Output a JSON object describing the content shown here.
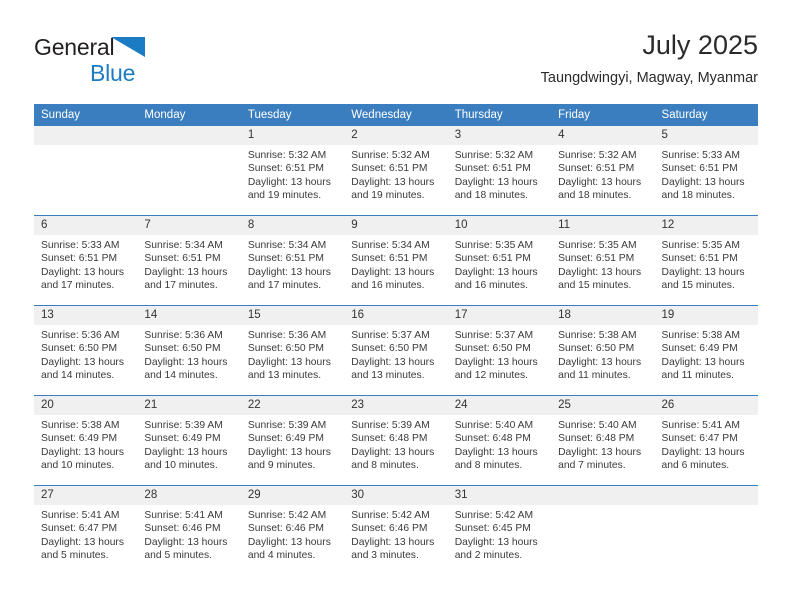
{
  "brand": {
    "name_part1": "General",
    "name_part2": "Blue",
    "logo_icon": "triangle-logo-icon",
    "color_dark": "#231f20",
    "color_blue": "#1b7cc4"
  },
  "header": {
    "title": "July 2025",
    "subtitle": "Taungdwingyi, Magway, Myanmar"
  },
  "theme": {
    "header_blue": "#3b7ebf",
    "daynum_band": "#f0f0f0",
    "text": "#3a3a3a"
  },
  "calendar": {
    "weekday_headers": [
      "Sunday",
      "Monday",
      "Tuesday",
      "Wednesday",
      "Thursday",
      "Friday",
      "Saturday"
    ],
    "weeks": [
      [
        {
          "day": "",
          "sunrise": "",
          "sunset": "",
          "daylight1": "",
          "daylight2": ""
        },
        {
          "day": "",
          "sunrise": "",
          "sunset": "",
          "daylight1": "",
          "daylight2": ""
        },
        {
          "day": "1",
          "sunrise": "Sunrise: 5:32 AM",
          "sunset": "Sunset: 6:51 PM",
          "daylight1": "Daylight: 13 hours",
          "daylight2": "and 19 minutes."
        },
        {
          "day": "2",
          "sunrise": "Sunrise: 5:32 AM",
          "sunset": "Sunset: 6:51 PM",
          "daylight1": "Daylight: 13 hours",
          "daylight2": "and 19 minutes."
        },
        {
          "day": "3",
          "sunrise": "Sunrise: 5:32 AM",
          "sunset": "Sunset: 6:51 PM",
          "daylight1": "Daylight: 13 hours",
          "daylight2": "and 18 minutes."
        },
        {
          "day": "4",
          "sunrise": "Sunrise: 5:32 AM",
          "sunset": "Sunset: 6:51 PM",
          "daylight1": "Daylight: 13 hours",
          "daylight2": "and 18 minutes."
        },
        {
          "day": "5",
          "sunrise": "Sunrise: 5:33 AM",
          "sunset": "Sunset: 6:51 PM",
          "daylight1": "Daylight: 13 hours",
          "daylight2": "and 18 minutes."
        }
      ],
      [
        {
          "day": "6",
          "sunrise": "Sunrise: 5:33 AM",
          "sunset": "Sunset: 6:51 PM",
          "daylight1": "Daylight: 13 hours",
          "daylight2": "and 17 minutes."
        },
        {
          "day": "7",
          "sunrise": "Sunrise: 5:34 AM",
          "sunset": "Sunset: 6:51 PM",
          "daylight1": "Daylight: 13 hours",
          "daylight2": "and 17 minutes."
        },
        {
          "day": "8",
          "sunrise": "Sunrise: 5:34 AM",
          "sunset": "Sunset: 6:51 PM",
          "daylight1": "Daylight: 13 hours",
          "daylight2": "and 17 minutes."
        },
        {
          "day": "9",
          "sunrise": "Sunrise: 5:34 AM",
          "sunset": "Sunset: 6:51 PM",
          "daylight1": "Daylight: 13 hours",
          "daylight2": "and 16 minutes."
        },
        {
          "day": "10",
          "sunrise": "Sunrise: 5:35 AM",
          "sunset": "Sunset: 6:51 PM",
          "daylight1": "Daylight: 13 hours",
          "daylight2": "and 16 minutes."
        },
        {
          "day": "11",
          "sunrise": "Sunrise: 5:35 AM",
          "sunset": "Sunset: 6:51 PM",
          "daylight1": "Daylight: 13 hours",
          "daylight2": "and 15 minutes."
        },
        {
          "day": "12",
          "sunrise": "Sunrise: 5:35 AM",
          "sunset": "Sunset: 6:51 PM",
          "daylight1": "Daylight: 13 hours",
          "daylight2": "and 15 minutes."
        }
      ],
      [
        {
          "day": "13",
          "sunrise": "Sunrise: 5:36 AM",
          "sunset": "Sunset: 6:50 PM",
          "daylight1": "Daylight: 13 hours",
          "daylight2": "and 14 minutes."
        },
        {
          "day": "14",
          "sunrise": "Sunrise: 5:36 AM",
          "sunset": "Sunset: 6:50 PM",
          "daylight1": "Daylight: 13 hours",
          "daylight2": "and 14 minutes."
        },
        {
          "day": "15",
          "sunrise": "Sunrise: 5:36 AM",
          "sunset": "Sunset: 6:50 PM",
          "daylight1": "Daylight: 13 hours",
          "daylight2": "and 13 minutes."
        },
        {
          "day": "16",
          "sunrise": "Sunrise: 5:37 AM",
          "sunset": "Sunset: 6:50 PM",
          "daylight1": "Daylight: 13 hours",
          "daylight2": "and 13 minutes."
        },
        {
          "day": "17",
          "sunrise": "Sunrise: 5:37 AM",
          "sunset": "Sunset: 6:50 PM",
          "daylight1": "Daylight: 13 hours",
          "daylight2": "and 12 minutes."
        },
        {
          "day": "18",
          "sunrise": "Sunrise: 5:38 AM",
          "sunset": "Sunset: 6:50 PM",
          "daylight1": "Daylight: 13 hours",
          "daylight2": "and 11 minutes."
        },
        {
          "day": "19",
          "sunrise": "Sunrise: 5:38 AM",
          "sunset": "Sunset: 6:49 PM",
          "daylight1": "Daylight: 13 hours",
          "daylight2": "and 11 minutes."
        }
      ],
      [
        {
          "day": "20",
          "sunrise": "Sunrise: 5:38 AM",
          "sunset": "Sunset: 6:49 PM",
          "daylight1": "Daylight: 13 hours",
          "daylight2": "and 10 minutes."
        },
        {
          "day": "21",
          "sunrise": "Sunrise: 5:39 AM",
          "sunset": "Sunset: 6:49 PM",
          "daylight1": "Daylight: 13 hours",
          "daylight2": "and 10 minutes."
        },
        {
          "day": "22",
          "sunrise": "Sunrise: 5:39 AM",
          "sunset": "Sunset: 6:49 PM",
          "daylight1": "Daylight: 13 hours",
          "daylight2": "and 9 minutes."
        },
        {
          "day": "23",
          "sunrise": "Sunrise: 5:39 AM",
          "sunset": "Sunset: 6:48 PM",
          "daylight1": "Daylight: 13 hours",
          "daylight2": "and 8 minutes."
        },
        {
          "day": "24",
          "sunrise": "Sunrise: 5:40 AM",
          "sunset": "Sunset: 6:48 PM",
          "daylight1": "Daylight: 13 hours",
          "daylight2": "and 8 minutes."
        },
        {
          "day": "25",
          "sunrise": "Sunrise: 5:40 AM",
          "sunset": "Sunset: 6:48 PM",
          "daylight1": "Daylight: 13 hours",
          "daylight2": "and 7 minutes."
        },
        {
          "day": "26",
          "sunrise": "Sunrise: 5:41 AM",
          "sunset": "Sunset: 6:47 PM",
          "daylight1": "Daylight: 13 hours",
          "daylight2": "and 6 minutes."
        }
      ],
      [
        {
          "day": "27",
          "sunrise": "Sunrise: 5:41 AM",
          "sunset": "Sunset: 6:47 PM",
          "daylight1": "Daylight: 13 hours",
          "daylight2": "and 5 minutes."
        },
        {
          "day": "28",
          "sunrise": "Sunrise: 5:41 AM",
          "sunset": "Sunset: 6:46 PM",
          "daylight1": "Daylight: 13 hours",
          "daylight2": "and 5 minutes."
        },
        {
          "day": "29",
          "sunrise": "Sunrise: 5:42 AM",
          "sunset": "Sunset: 6:46 PM",
          "daylight1": "Daylight: 13 hours",
          "daylight2": "and 4 minutes."
        },
        {
          "day": "30",
          "sunrise": "Sunrise: 5:42 AM",
          "sunset": "Sunset: 6:46 PM",
          "daylight1": "Daylight: 13 hours",
          "daylight2": "and 3 minutes."
        },
        {
          "day": "31",
          "sunrise": "Sunrise: 5:42 AM",
          "sunset": "Sunset: 6:45 PM",
          "daylight1": "Daylight: 13 hours",
          "daylight2": "and 2 minutes."
        },
        {
          "day": "",
          "sunrise": "",
          "sunset": "",
          "daylight1": "",
          "daylight2": ""
        },
        {
          "day": "",
          "sunrise": "",
          "sunset": "",
          "daylight1": "",
          "daylight2": ""
        }
      ]
    ]
  }
}
